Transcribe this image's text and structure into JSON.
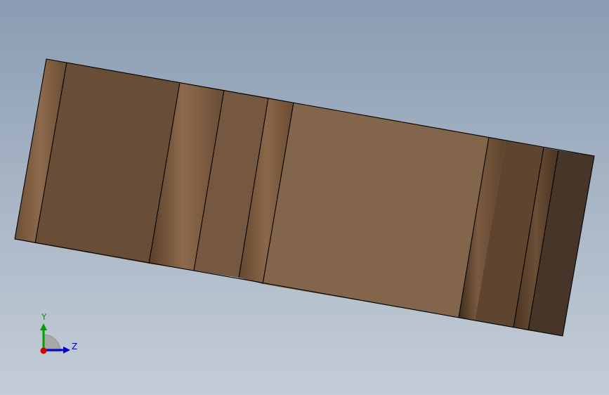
{
  "viewport": {
    "background_top": "#8a9cb2",
    "background_bottom": "#c4cdd7"
  },
  "model": {
    "part_color": "#7a5a40",
    "edge_color": "#000000"
  },
  "triad": {
    "y_label": "Y",
    "z_label": "Z",
    "y_color": "#00a000",
    "z_color": "#0000d0",
    "x_color": "#d00000"
  }
}
